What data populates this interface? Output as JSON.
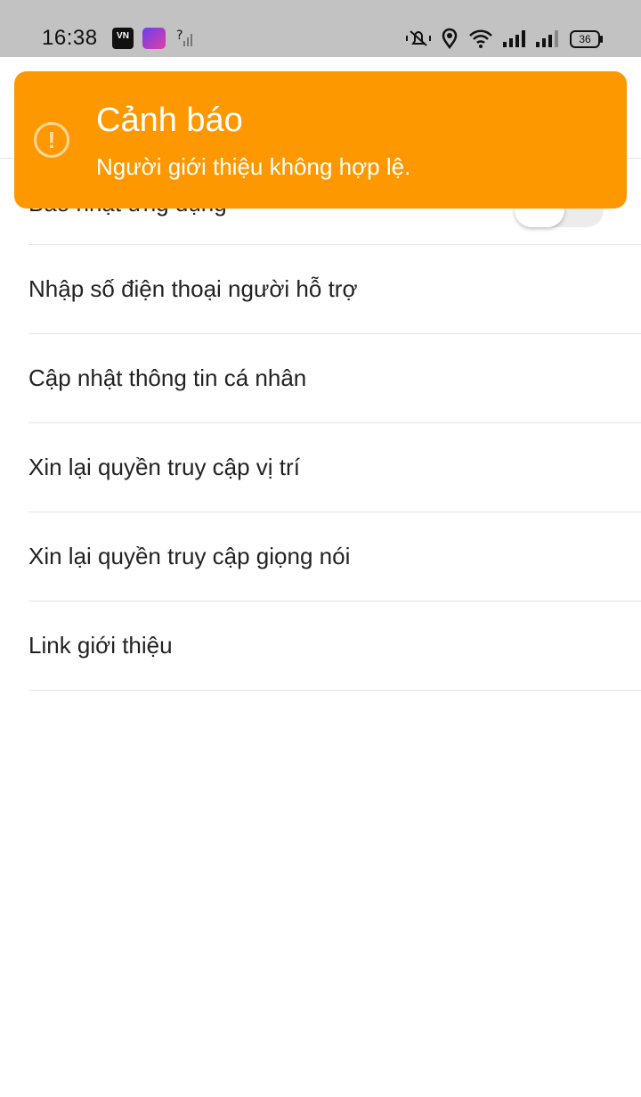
{
  "status_bar": {
    "time": "16:38",
    "app_icon_vn_text": "VN",
    "battery": "36"
  },
  "toast": {
    "title": "Cảnh báo",
    "message": "Người giới thiệu không hợp lệ.",
    "icon_glyph": "!",
    "color": "#fd9801"
  },
  "settings": {
    "items": [
      {
        "label": "Báo nhật ứng dụng",
        "toggle_on": false
      },
      {
        "label": "Nhập số điện thoại người hỗ trợ"
      },
      {
        "label": "Cập nhật thông tin cá nhân"
      },
      {
        "label": "Xin lại quyền truy cập vị trí"
      },
      {
        "label": "Xin lại quyền truy cập giọng nói"
      },
      {
        "label": "Link giới thiệu"
      }
    ]
  }
}
